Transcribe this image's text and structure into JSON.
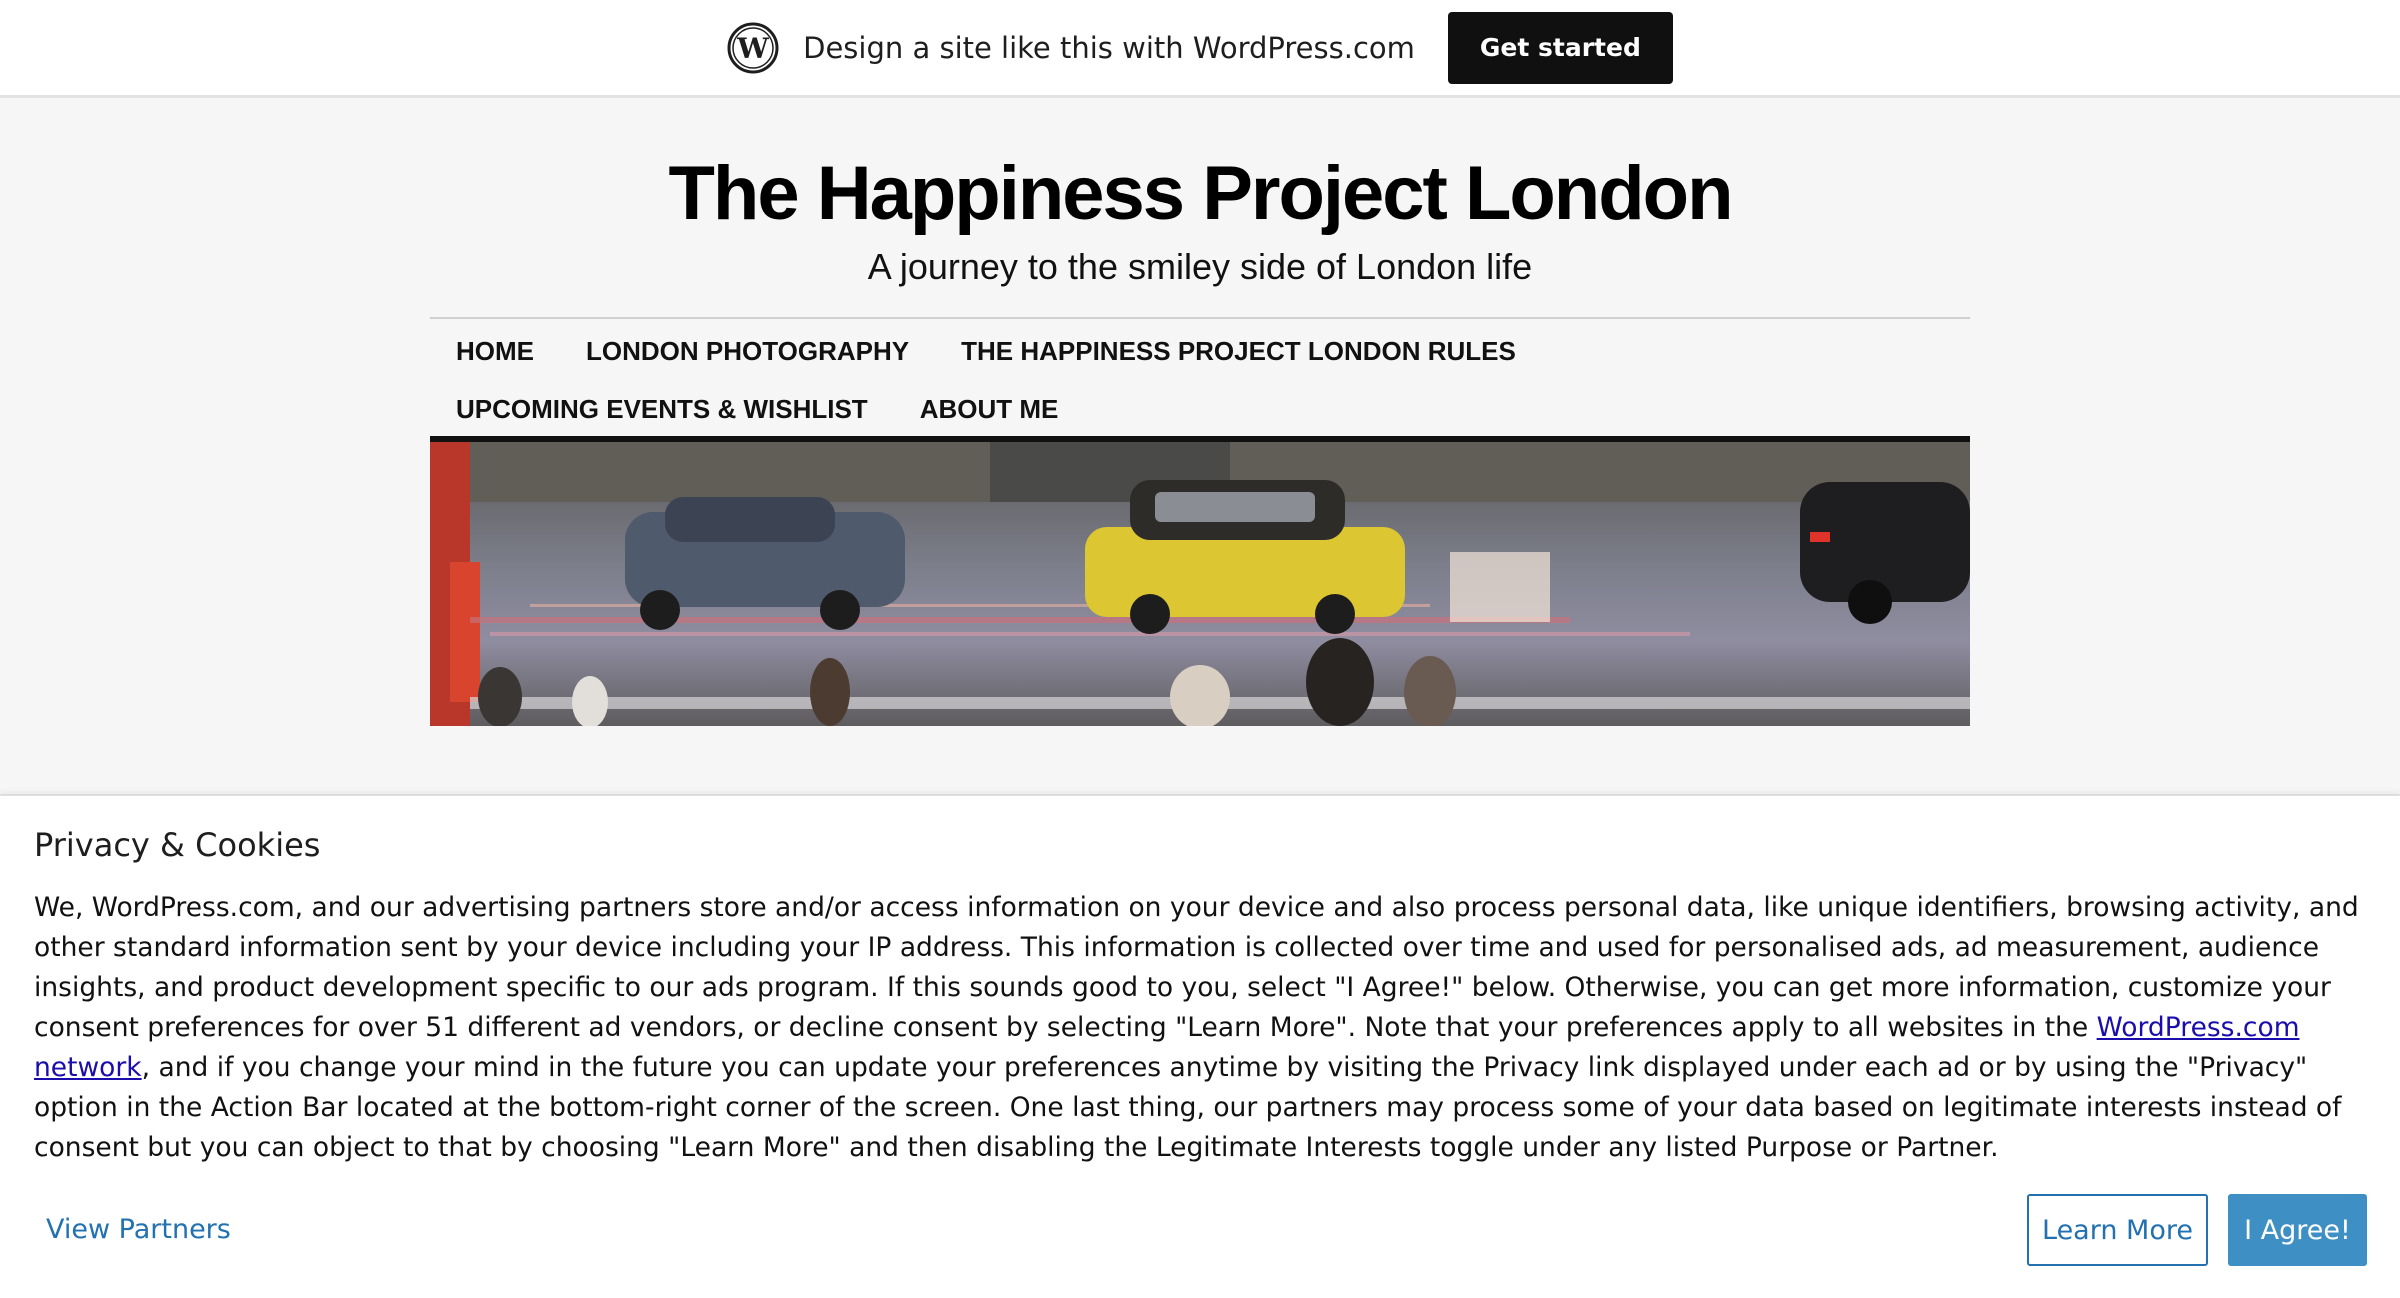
{
  "banner": {
    "logo_icon": "wordpress-logo-icon",
    "text": "Design a site like this with WordPress.com",
    "button_label": "Get started"
  },
  "site": {
    "title": "The Happiness Project London",
    "tagline": "A journey to the smiley side of London life"
  },
  "nav": {
    "row1": [
      "HOME",
      "LONDON PHOTOGRAPHY",
      "THE HAPPINESS PROJECT LONDON RULES"
    ],
    "row2": [
      "UPCOMING EVENTS & WISHLIST",
      "ABOUT ME"
    ]
  },
  "cookie": {
    "title": "Privacy & Cookies",
    "body_part1": "We, WordPress.com, and our advertising partners store and/or access information on your device and also process personal data, like unique identifiers, browsing activity, and other standard information sent by your device including your IP address. This information is collected over time and used for personalised ads, ad measurement, audience insights, and product development specific to our ads program. If this sounds good to you, select \"I Agree!\" below. Otherwise, you can get more information, customize your consent preferences for over 51 different ad vendors, or decline consent by selecting \"Learn More\". Note that your preferences apply to all websites in the ",
    "link_text": "WordPress.com network",
    "body_part2": ", and if you change your mind in the future you can update your preferences anytime by visiting the Privacy link displayed under each ad or by using the \"Privacy\" option in the Action Bar located at the bottom-right corner of the screen. One last thing, our partners may process some of your data based on legitimate interests instead of consent but you can object to that by choosing \"Learn More\" and then disabling the Legitimate Interests toggle under any listed Purpose or Partner.",
    "view_partners": "View Partners",
    "learn_more": "Learn More",
    "agree": "I Agree!"
  },
  "colors": {
    "link_blue": "#2271b1",
    "agree_bg": "#3d8fc4",
    "banner_button_bg": "#101010"
  }
}
